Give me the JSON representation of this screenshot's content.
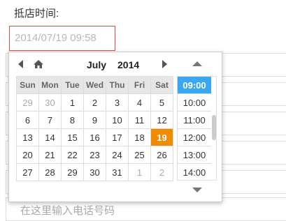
{
  "form": {
    "arrival_label": "抵店时间:",
    "arrival_value": "2014/07/19 09:58",
    "phone_placeholder": "在这里输入电话号码"
  },
  "picker": {
    "month": "July",
    "year": "2014",
    "weekdays": [
      "Sun",
      "Mon",
      "Tue",
      "Wed",
      "Thu",
      "Fri",
      "Sat"
    ],
    "weeks": [
      [
        "29",
        "30",
        "1",
        "2",
        "3",
        "4",
        "5"
      ],
      [
        "6",
        "7",
        "8",
        "9",
        "10",
        "11",
        "12"
      ],
      [
        "13",
        "14",
        "15",
        "16",
        "17",
        "18",
        "19"
      ],
      [
        "20",
        "21",
        "22",
        "23",
        "24",
        "25",
        "26"
      ],
      [
        "27",
        "28",
        "29",
        "30",
        "31",
        "1",
        "2"
      ]
    ],
    "selected_day": "19",
    "times": [
      "09:00",
      "10:00",
      "11:00",
      "12:00",
      "13:00",
      "14:00"
    ],
    "selected_time": "09:00",
    "colors": {
      "selected_day": "#f08a00",
      "selected_time": "#3aa8f0",
      "input_border": "#d94b4b"
    },
    "icons": [
      "prev-month-icon",
      "home-icon",
      "next-month-icon",
      "time-up-icon",
      "time-down-icon"
    ]
  }
}
